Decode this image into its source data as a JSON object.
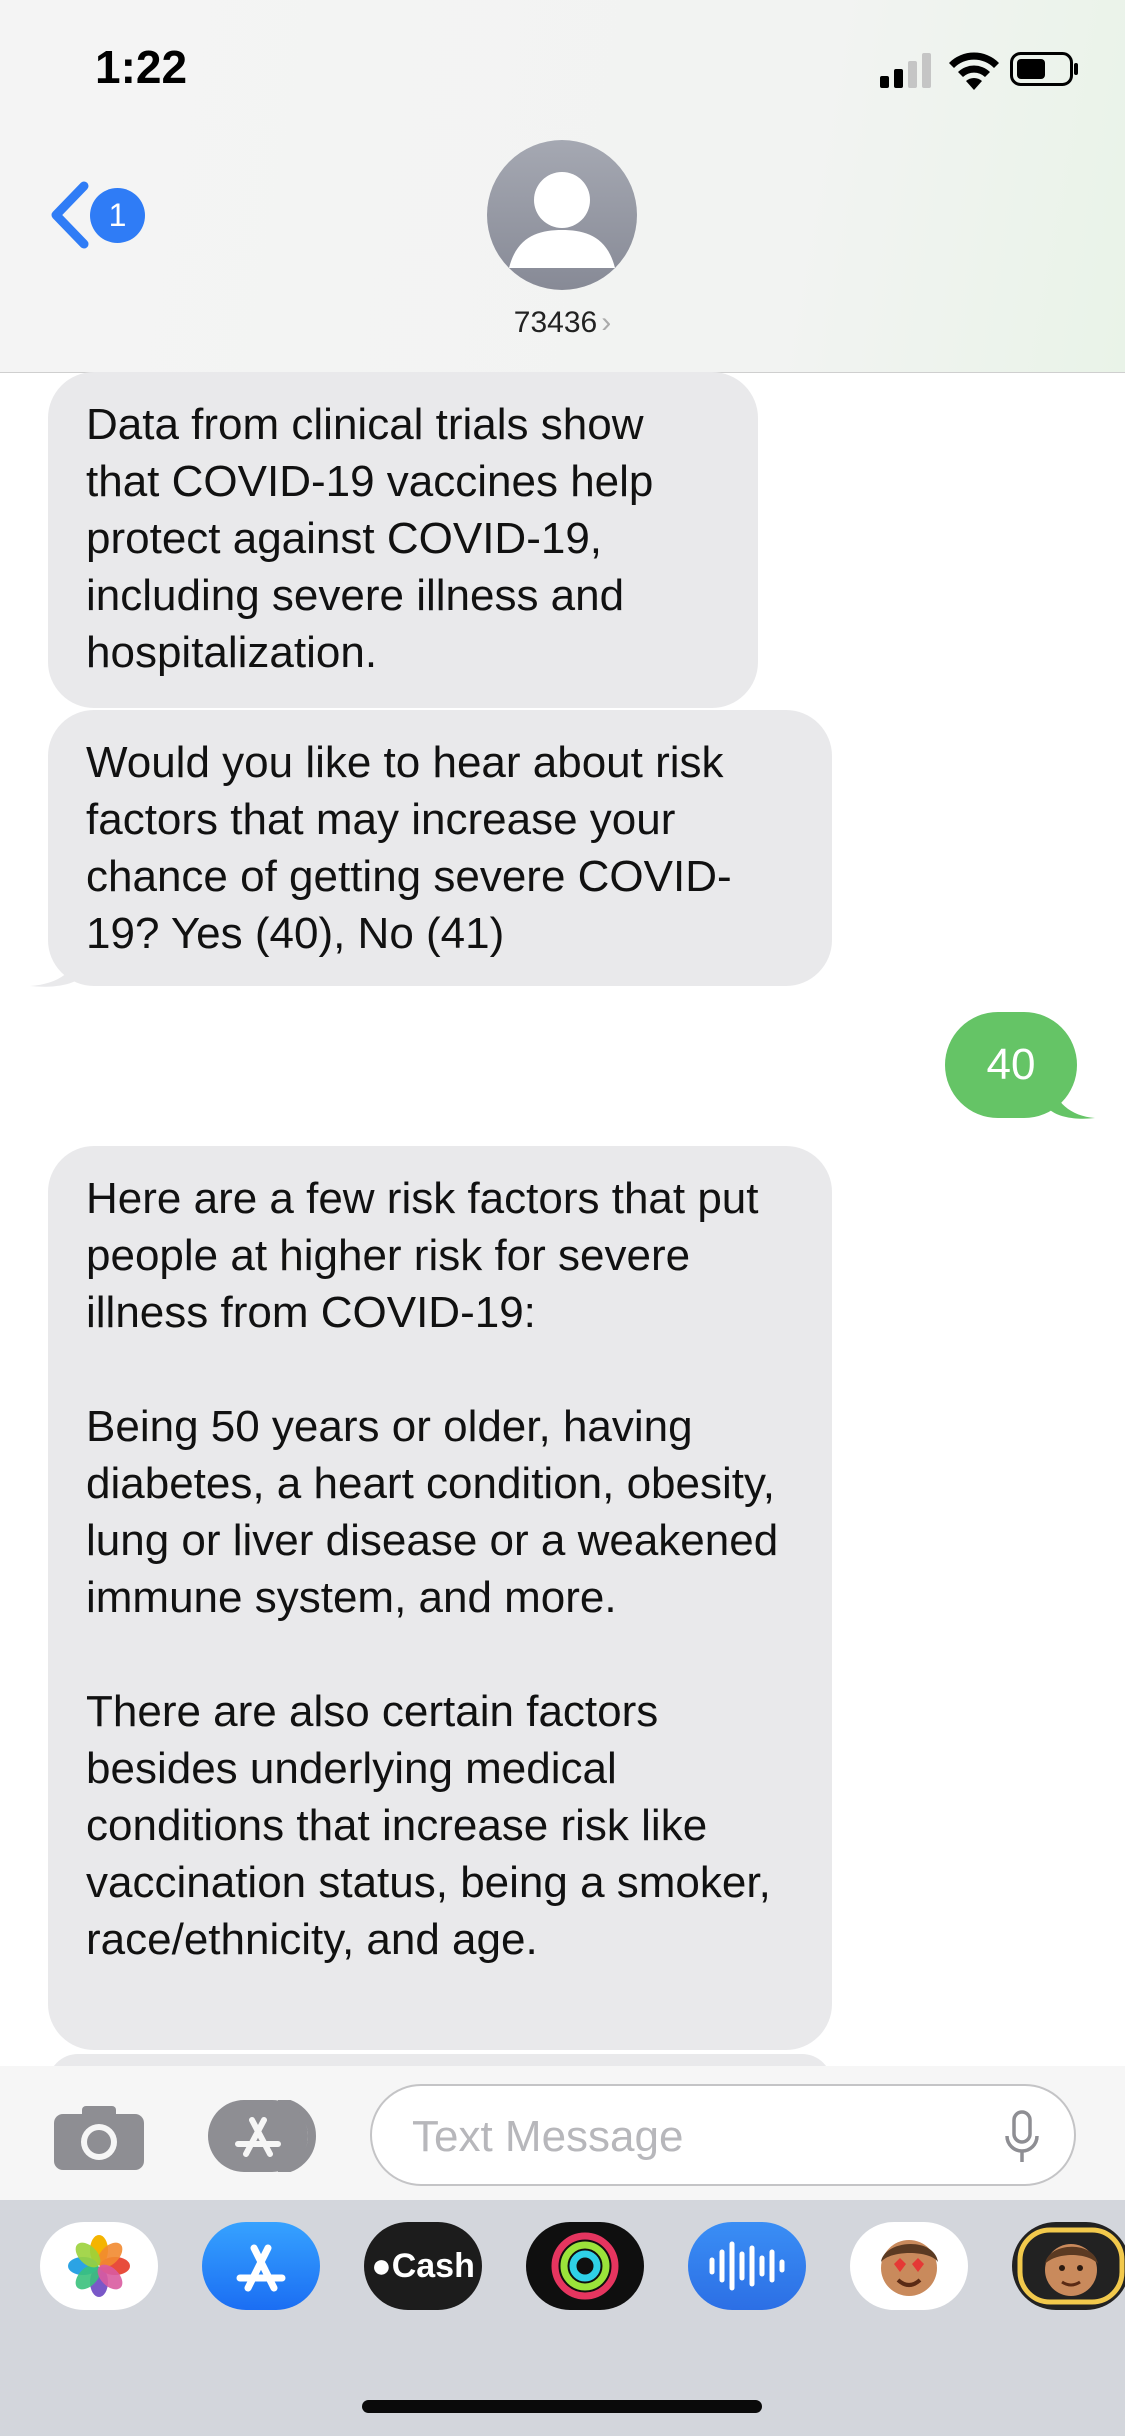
{
  "status": {
    "time": "1:22"
  },
  "header": {
    "back_badge": "1",
    "contact": "73436"
  },
  "messages": [
    {
      "from": "them",
      "text": "Data from clinical trials show that COVID-19 vaccines help protect against COVID-19, including severe illness and hospitalization."
    },
    {
      "from": "them",
      "text": "Would you like to hear about risk factors that may increase your chance of getting severe COVID-19? Yes (40), No (41)"
    },
    {
      "from": "me",
      "text": "40"
    },
    {
      "from": "them",
      "text": "Here are a few risk factors that put people at higher risk for severe illness from COVID-19:\n\nBeing 50 years or older, having diabetes, a heart condition, obesity, lung or liver disease or a weakened immune system, and more.\n\nThere are also certain factors besides underlying medical conditions that increase risk like vaccination status, being a smoker, race/ethnicity, and age."
    }
  ],
  "input": {
    "placeholder": "Text Message"
  },
  "app_drawer": {
    "apps": [
      "photos-icon",
      "app-store-icon",
      "cash-app-icon",
      "activity-icon",
      "voice-memo-icon",
      "memoji-icon",
      "memoji-icon"
    ],
    "cash_label": "Cash"
  },
  "colors": {
    "sent_bubble": "#65c466",
    "received_bubble": "#e9e9eb",
    "badge": "#2f7cf6"
  }
}
